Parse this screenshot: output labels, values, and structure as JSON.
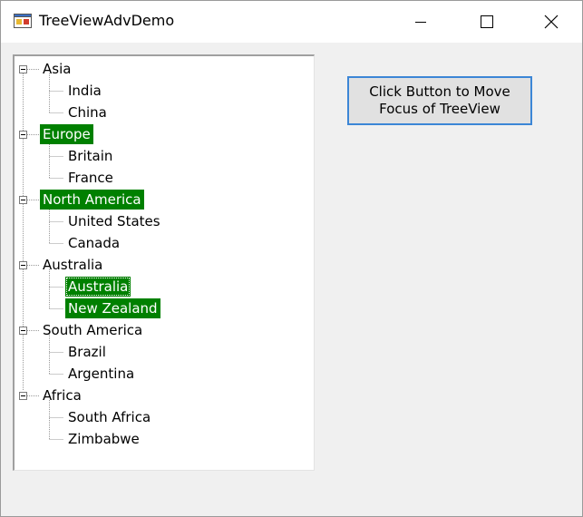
{
  "window": {
    "title": "TreeViewAdvDemo"
  },
  "tree": {
    "groups": [
      {
        "label": "Asia",
        "selected": false,
        "children": [
          {
            "label": "India",
            "selected": false
          },
          {
            "label": "China",
            "selected": false
          }
        ]
      },
      {
        "label": "Europe",
        "selected": true,
        "children": [
          {
            "label": "Britain",
            "selected": false
          },
          {
            "label": "France",
            "selected": false
          }
        ]
      },
      {
        "label": "North America",
        "selected": true,
        "children": [
          {
            "label": "United States",
            "selected": false
          },
          {
            "label": "Canada",
            "selected": false
          }
        ]
      },
      {
        "label": "Australia",
        "selected": false,
        "children": [
          {
            "label": "Australia",
            "selected": true,
            "focused": true
          },
          {
            "label": "New Zealand",
            "selected": true
          }
        ]
      },
      {
        "label": "South America",
        "selected": false,
        "children": [
          {
            "label": "Brazil",
            "selected": false
          },
          {
            "label": "Argentina",
            "selected": false
          }
        ]
      },
      {
        "label": "Africa",
        "selected": false,
        "children": [
          {
            "label": "South Africa",
            "selected": false
          },
          {
            "label": "Zimbabwe",
            "selected": false
          }
        ]
      }
    ]
  },
  "button": {
    "label": "Click Button to Move Focus of TreeView"
  },
  "colors": {
    "selection": "#008000",
    "button_border": "#3c86d6"
  }
}
